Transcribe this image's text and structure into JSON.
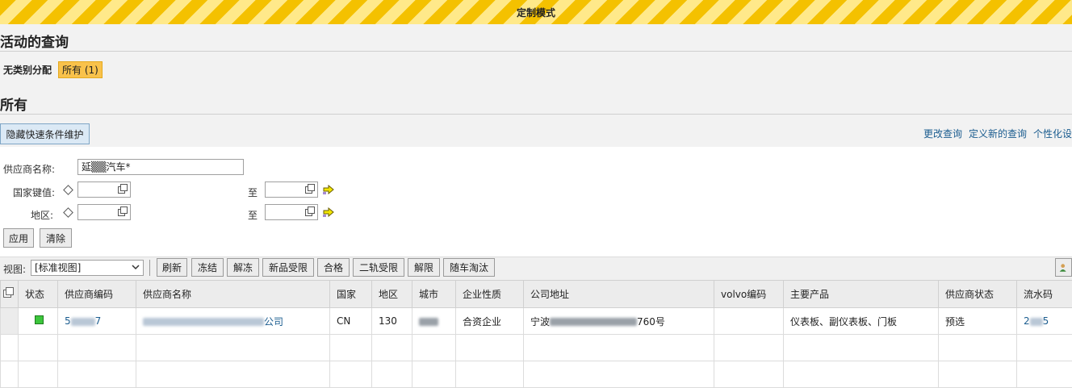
{
  "banner": {
    "title": "定制模式"
  },
  "active_queries": {
    "title": "活动的查询"
  },
  "category": {
    "label": "无类别分配",
    "all": "所有 (1)"
  },
  "section": {
    "title": "所有"
  },
  "quick": {
    "hide_button": "隐藏快速条件维护",
    "links": [
      "更改查询",
      "定义新的查询",
      "个性化设"
    ]
  },
  "criteria": {
    "supplier_name_label": "供应商名称:",
    "supplier_name_value": "延▒▒汽车*",
    "country_label": "国家键值:",
    "region_label": "地区:",
    "to_label": "至",
    "apply": "应用",
    "clear": "清除"
  },
  "toolbar": {
    "view_label": "视图:",
    "view_value": "[标准视图]",
    "buttons": [
      "刷新",
      "冻结",
      "解冻",
      "新品受限",
      "合格",
      "二轨受限",
      "解限",
      "随车淘汰"
    ]
  },
  "table": {
    "headers": [
      "状态",
      "供应商编码",
      "供应商名称",
      "国家",
      "地区",
      "城市",
      "企业性质",
      "公司地址",
      "volvo编码",
      "主要产品",
      "供应商状态",
      "流水码"
    ],
    "row": {
      "code_prefix": "5",
      "code_suffix": "7",
      "name_suffix": "公司",
      "country": "CN",
      "region": "130",
      "city_suffix": "",
      "nature": "合资企业",
      "address_prefix": "宁波",
      "address_suffix": "760号",
      "volvo": "",
      "products": "仪表板、副仪表板、门板",
      "status": "预选",
      "serial_prefix": "2",
      "serial_suffix": "5"
    }
  }
}
